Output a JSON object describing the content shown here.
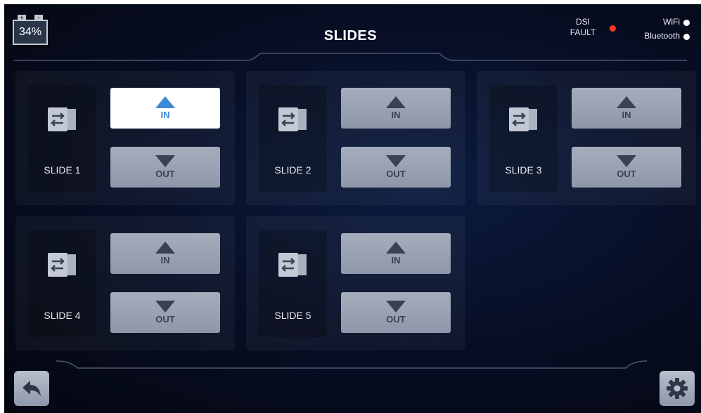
{
  "header": {
    "title": "SLIDES",
    "battery": {
      "level": "34%",
      "plus": "+",
      "minus": "-"
    },
    "dsi_fault": {
      "line1": "DSI",
      "line2": "FAULT",
      "status_color": "#ff3b1e"
    },
    "wifi": {
      "label": "WiFi",
      "status_color": "#ffffff"
    },
    "bluetooth": {
      "label": "Bluetooth",
      "status_color": "#ffffff"
    }
  },
  "slides": [
    {
      "name": "SLIDE 1",
      "in_label": "IN",
      "out_label": "OUT",
      "active": "in"
    },
    {
      "name": "SLIDE 2",
      "in_label": "IN",
      "out_label": "OUT",
      "active": "none"
    },
    {
      "name": "SLIDE 3",
      "in_label": "IN",
      "out_label": "OUT",
      "active": "none"
    },
    {
      "name": "SLIDE 4",
      "in_label": "IN",
      "out_label": "OUT",
      "active": "none"
    },
    {
      "name": "SLIDE 5",
      "in_label": "IN",
      "out_label": "OUT",
      "active": "none"
    }
  ],
  "footer": {
    "back_icon": "back-arrow-icon",
    "settings_icon": "gear-icon"
  },
  "colors": {
    "accent": "#3a8ad8",
    "button": "#a5adbd",
    "background": "#070d22"
  }
}
